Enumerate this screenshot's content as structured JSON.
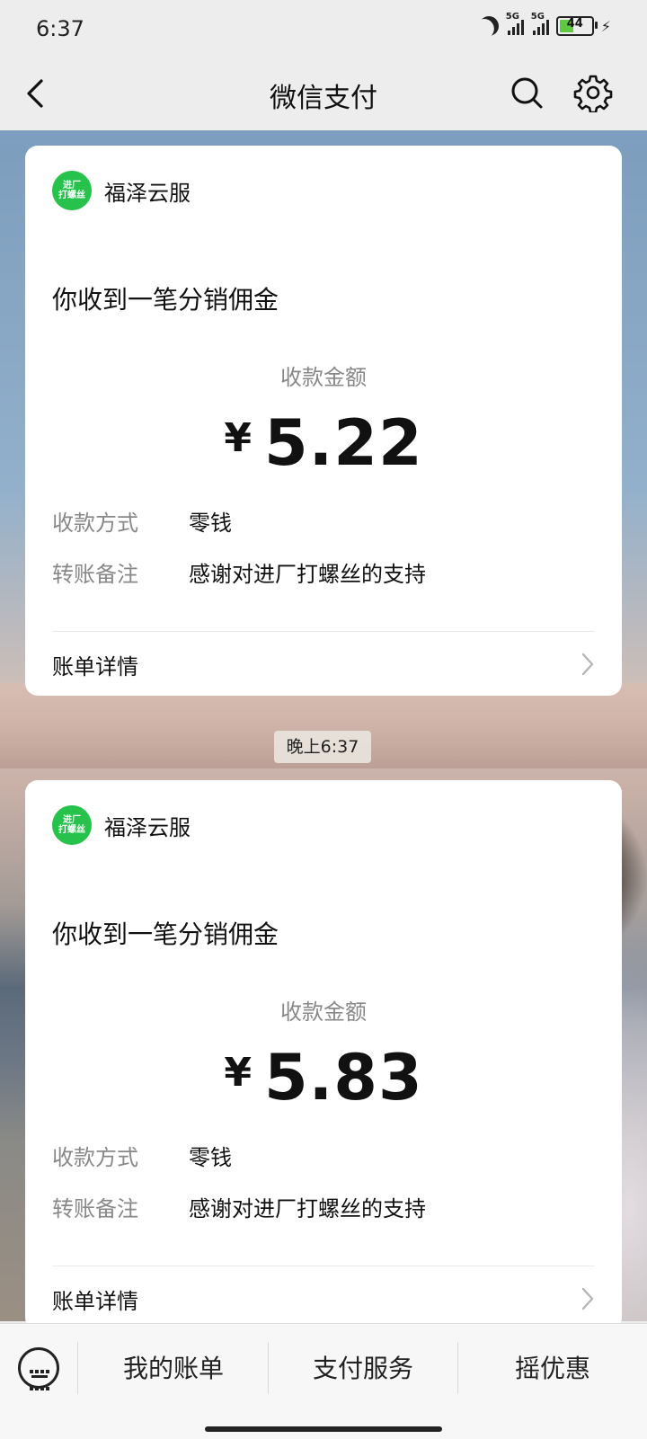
{
  "status_bar": {
    "time": "6:37",
    "signal_1_label": "5G",
    "signal_2_label": "5G",
    "battery": "44",
    "battery_level": 0.44,
    "battery_color": "#5ec940"
  },
  "header": {
    "title": "微信支付",
    "back_icon": "chevron-left-icon",
    "search_icon": "search-icon",
    "settings_icon": "gear-icon"
  },
  "cards": [
    {
      "merchant_logo_line1": "进厂",
      "merchant_logo_line2": "打螺丝",
      "merchant_name": "福泽云服",
      "title": "你收到一笔分销佣金",
      "amount_label": "收款金额",
      "currency": "¥",
      "amount": "5.22",
      "method_key": "收款方式",
      "method_value": "零钱",
      "note_key": "转账备注",
      "note_value": "感谢对进厂打螺丝的支持",
      "detail_label": "账单详情"
    },
    {
      "merchant_logo_line1": "进厂",
      "merchant_logo_line2": "打螺丝",
      "merchant_name": "福泽云服",
      "title": "你收到一笔分销佣金",
      "amount_label": "收款金额",
      "currency": "¥",
      "amount": "5.83",
      "method_key": "收款方式",
      "method_value": "零钱",
      "note_key": "转账备注",
      "note_value": "感谢对进厂打螺丝的支持",
      "detail_label": "账单详情"
    }
  ],
  "timestamp": "晚上6:37",
  "bottom_menu": {
    "keyboard_icon": "keyboard-icon",
    "items": [
      "我的账单",
      "支付服务",
      "摇优惠"
    ]
  },
  "colors": {
    "logo_green": "#27c24c",
    "header_bg": "#ededed"
  }
}
